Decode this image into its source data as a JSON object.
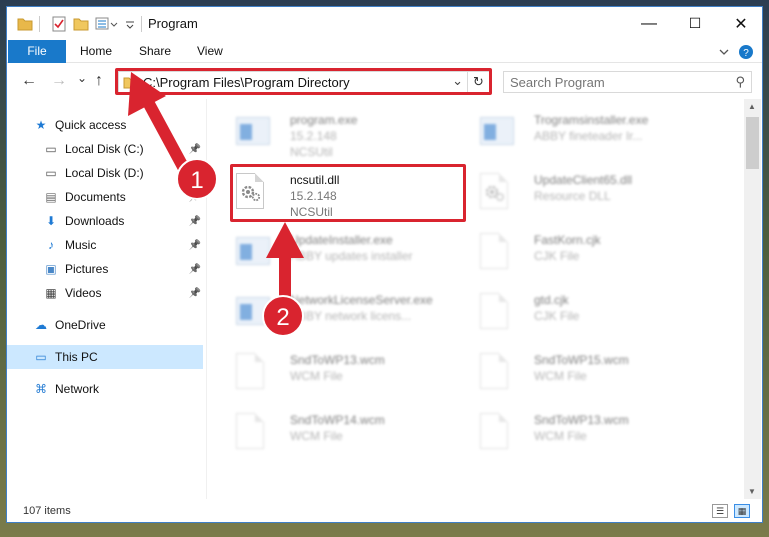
{
  "window": {
    "title": "Program",
    "controls": {
      "minimize": "—",
      "maximize": "☐",
      "close": "✕"
    }
  },
  "ribbon": {
    "tabs": [
      {
        "label": "File"
      },
      {
        "label": "Home"
      },
      {
        "label": "Share"
      },
      {
        "label": "View"
      }
    ],
    "expand_icon": "chevron-down-icon",
    "help_icon": "help-icon"
  },
  "navigation": {
    "back": "←",
    "forward": "→",
    "recent": "⌄",
    "up": "↑",
    "address": "C:\\Program Files\\Program Directory",
    "address_dropdown": "⌄",
    "refresh": "↻",
    "search_placeholder": "Search Program",
    "search_glyph": "⚲"
  },
  "sidebar": {
    "items": [
      {
        "label": "Quick access",
        "icon": "star-icon",
        "glyph": "★",
        "color": "#1e7ad4",
        "pinned": false
      },
      {
        "label": "Local Disk (C:)",
        "icon": "disk-icon",
        "glyph": "▭",
        "color": "#555555",
        "pinned": true
      },
      {
        "label": "Local Disk (D:)",
        "icon": "disk-icon",
        "glyph": "▭",
        "color": "#555555",
        "pinned": true
      },
      {
        "label": "Documents",
        "icon": "documents-icon",
        "glyph": "▤",
        "color": "#6a6a6a",
        "pinned": true
      },
      {
        "label": "Downloads",
        "icon": "download-icon",
        "glyph": "⬇",
        "color": "#1e7ad4",
        "pinned": true
      },
      {
        "label": "Music",
        "icon": "music-icon",
        "glyph": "♪",
        "color": "#1e7ad4",
        "pinned": true
      },
      {
        "label": "Pictures",
        "icon": "pictures-icon",
        "glyph": "▣",
        "color": "#4a88c8",
        "pinned": true
      },
      {
        "label": "Videos",
        "icon": "videos-icon",
        "glyph": "▦",
        "color": "#444444",
        "pinned": true
      },
      {
        "label": "OneDrive",
        "icon": "cloud-icon",
        "glyph": "☁",
        "color": "#1e7ad4",
        "pinned": false
      },
      {
        "label": "This PC",
        "icon": "computer-icon",
        "glyph": "▭",
        "color": "#2a7fd4",
        "pinned": false,
        "selected": true
      },
      {
        "label": "Network",
        "icon": "network-icon",
        "glyph": "⌘",
        "color": "#2a7fd4",
        "pinned": false
      }
    ],
    "pin_glyph": "📌"
  },
  "files": [
    {
      "name": "program.exe",
      "line2": "15.2.148",
      "line3": "NCSUtil",
      "type": "exe",
      "faded": true
    },
    {
      "name": "Trogramsinstaller.exe",
      "line2": "ABBY fineteader Ir...",
      "type": "exe",
      "faded": true
    },
    {
      "name": "ncsutil.dll",
      "line2": "15.2.148",
      "line3": "NCSUtil",
      "type": "dll",
      "faded": false,
      "highlighted": true
    },
    {
      "name": "UpdateClient65.dll",
      "line2": "Resource DLL",
      "type": "dll",
      "faded": true
    },
    {
      "name": "UpdateInstaller.exe",
      "line2": "ABBY updates installer",
      "type": "exe",
      "faded": true
    },
    {
      "name": "FastKorn.cjk",
      "line2": "CJK File",
      "type": "doc",
      "faded": true
    },
    {
      "name": "NetworkLicenseServer.exe",
      "line2": "ABBY network licens...",
      "type": "exe",
      "faded": true
    },
    {
      "name": "gtd.cjk",
      "line2": "CJK File",
      "type": "doc",
      "faded": true
    },
    {
      "name": "SndToWP13.wcm",
      "line2": "WCM File",
      "type": "doc",
      "faded": true
    },
    {
      "name": "SndToWP15.wcm",
      "line2": "WCM File",
      "type": "doc",
      "faded": true
    },
    {
      "name": "SndToWP14.wcm",
      "line2": "WCM File",
      "type": "doc",
      "faded": true
    },
    {
      "name": "SndToWP13.wcm",
      "line2": "WCM File",
      "type": "doc",
      "faded": true
    }
  ],
  "status": {
    "items_count": "107 items",
    "details_view": "☰",
    "tiles_view": "▦"
  },
  "annotations": [
    {
      "number": "1",
      "color": "#d9242f"
    },
    {
      "number": "2",
      "color": "#d9242f"
    }
  ],
  "colors": {
    "accent": "#1979ca",
    "highlight": "#d9242f",
    "selected": "#cce8ff"
  }
}
